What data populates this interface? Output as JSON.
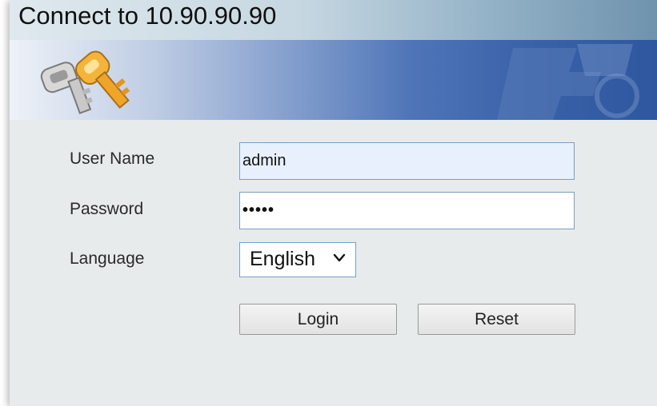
{
  "window": {
    "title": "Connect to 10.90.90.90"
  },
  "form": {
    "username_label": "User Name",
    "username_value": "admin",
    "password_label": "Password",
    "password_value": "•••••",
    "language_label": "Language",
    "language_selected": "English"
  },
  "buttons": {
    "login_label": "Login",
    "reset_label": "Reset"
  },
  "icons": {
    "banner": "keys-icon",
    "select": "chevron-down-icon"
  },
  "colors": {
    "field_border": "#7aa0c4",
    "banner_blue": "#3a62a9",
    "panel_bg": "#e7ebeb"
  }
}
